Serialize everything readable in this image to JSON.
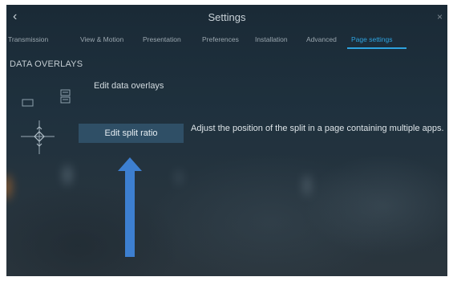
{
  "header": {
    "back_glyph": "‹",
    "title": "Settings",
    "close_glyph": "×"
  },
  "tabs": [
    {
      "label": "Transmission",
      "active": false
    },
    {
      "label": "View & Motion",
      "active": false
    },
    {
      "label": "Presentation",
      "active": false
    },
    {
      "label": "Preferences",
      "active": false
    },
    {
      "label": "Installation",
      "active": false
    },
    {
      "label": "Advanced",
      "active": false
    },
    {
      "label": "Page settings",
      "active": true
    }
  ],
  "section": {
    "title": "DATA OVERLAYS"
  },
  "rows": {
    "edit_data_overlays": {
      "label": "Edit data overlays"
    },
    "edit_split_ratio": {
      "button_label": "Edit split ratio",
      "description": "Adjust the position of the split in a page containing multiple apps."
    }
  },
  "colors": {
    "accent": "#2ea3e0",
    "button_bg": "#2f4f66",
    "arrow": "#3d7fd0"
  },
  "icons": [
    "back-icon",
    "close-icon",
    "data-overlay-icon",
    "split-ratio-icon",
    "up-arrow-icon"
  ]
}
